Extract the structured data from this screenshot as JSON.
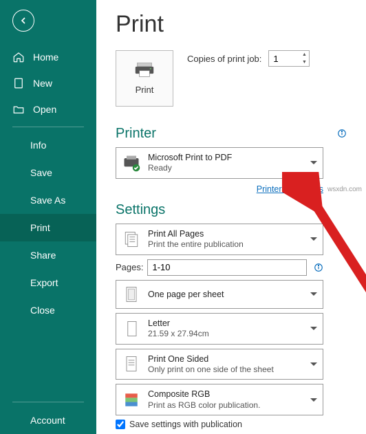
{
  "sidebar": {
    "home": "Home",
    "new": "New",
    "open": "Open",
    "info": "Info",
    "save": "Save",
    "saveas": "Save As",
    "print": "Print",
    "share": "Share",
    "export": "Export",
    "close": "Close",
    "account": "Account"
  },
  "page": {
    "title": "Print",
    "print_button": "Print",
    "copies_label": "Copies of print job:",
    "copies_value": "1"
  },
  "printer": {
    "section_title": "Printer",
    "name": "Microsoft Print to PDF",
    "status": "Ready",
    "properties_link": "Printer Properties"
  },
  "settings": {
    "section_title": "Settings",
    "print_pages": {
      "title": "Print All Pages",
      "sub": "Print the entire publication"
    },
    "pages_label": "Pages:",
    "pages_value": "1-10",
    "per_sheet": {
      "title": "One page per sheet",
      "sub": ""
    },
    "paper": {
      "title": "Letter",
      "sub": "21.59 x 27.94cm"
    },
    "sided": {
      "title": "Print One Sided",
      "sub": "Only print on one side of the sheet"
    },
    "color": {
      "title": "Composite RGB",
      "sub": "Print as RGB color publication."
    },
    "save_settings": "Save settings with publication"
  },
  "watermark": "wsxdn.com"
}
